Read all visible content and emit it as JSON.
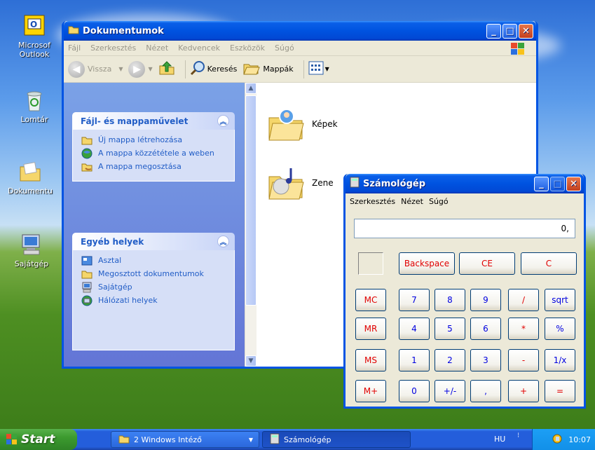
{
  "desktop": {
    "icons": [
      {
        "label": "Microsof Outlook",
        "icon": "outlook-icon"
      },
      {
        "label": "Lomtár",
        "icon": "recycle-bin-icon"
      },
      {
        "label": "Dokumentu",
        "icon": "documents-folder-icon"
      },
      {
        "label": "Sajátgép",
        "icon": "my-computer-icon"
      }
    ]
  },
  "explorer": {
    "title": "Dokumentumok",
    "menu": [
      "Fájl",
      "Szerkesztés",
      "Nézet",
      "Kedvencek",
      "Eszközök",
      "Súgó"
    ],
    "toolbar": {
      "back": "Vissza",
      "search": "Keresés",
      "folders": "Mappák"
    },
    "tasks_panel": {
      "title": "Fájl- és mappaművelet",
      "items": [
        "Új mappa létrehozása",
        "A mappa közzététele a weben",
        "A mappa megosztása"
      ]
    },
    "places_panel": {
      "title": "Egyéb helyek",
      "items": [
        "Asztal",
        "Megosztott dokumentumok",
        "Sajátgép",
        "Hálózati helyek"
      ]
    },
    "files": [
      "Képek",
      "Zene"
    ]
  },
  "calculator": {
    "title": "Számológép",
    "menu": [
      "Szerkesztés",
      "Nézet",
      "Súgó"
    ],
    "display": "0,",
    "top_buttons": [
      "Backspace",
      "CE",
      "C"
    ],
    "memory_buttons": [
      "MC",
      "MR",
      "MS",
      "M+"
    ],
    "rows": [
      [
        "7",
        "8",
        "9",
        "/",
        "sqrt"
      ],
      [
        "4",
        "5",
        "6",
        "*",
        "%"
      ],
      [
        "1",
        "2",
        "3",
        "-",
        "1/x"
      ],
      [
        "0",
        "+/-",
        ",",
        "+",
        "="
      ]
    ]
  },
  "taskbar": {
    "start": "Start",
    "tasks": [
      "2 Windows Intéző",
      "Számológép"
    ],
    "lang": "HU",
    "clock": "10:07"
  },
  "colors": {
    "title_blue": "#0054e3",
    "taskbar_blue": "#245edb",
    "start_green": "#3c9a2f",
    "link_blue": "#215dc6"
  }
}
